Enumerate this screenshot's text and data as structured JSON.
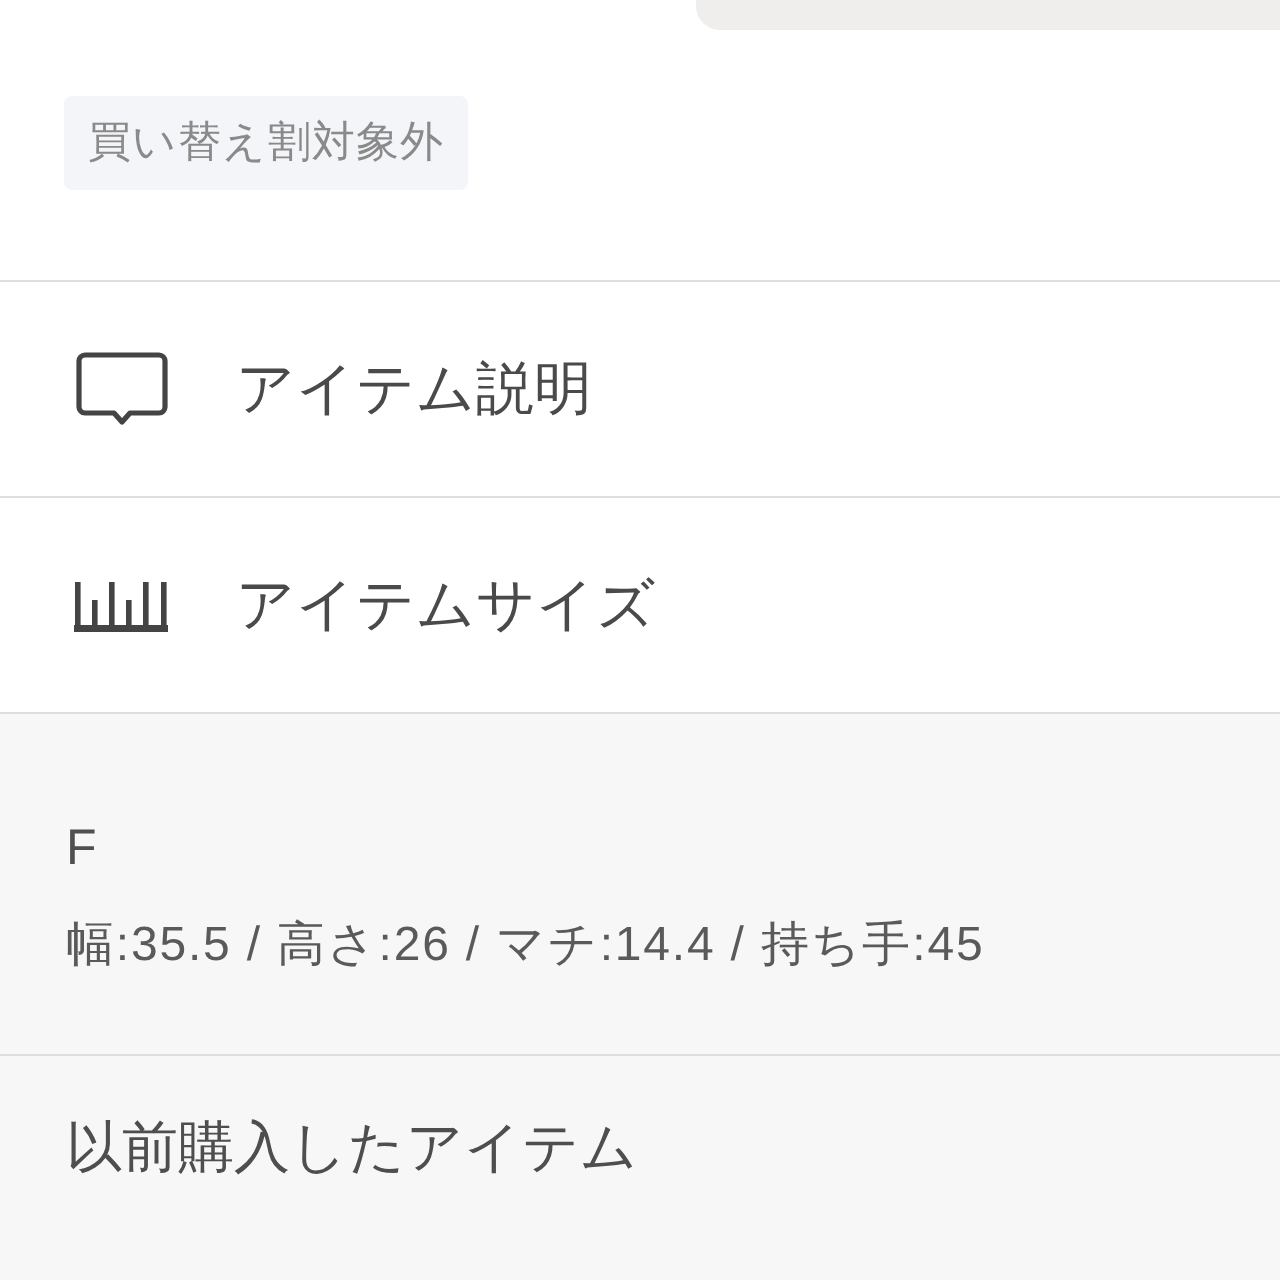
{
  "badge": "買い替え割対象外",
  "menu_items": [
    {
      "kind": "description",
      "label": "アイテム説明"
    },
    {
      "kind": "size",
      "label": "アイテムサイズ"
    }
  ],
  "size_info": {
    "size_label": "F",
    "dimensions": "幅:35.5 / 高さ:26 / マチ:14.4 / 持ち手:45"
  },
  "purchase_history": {
    "title": "以前購入したアイテム"
  }
}
